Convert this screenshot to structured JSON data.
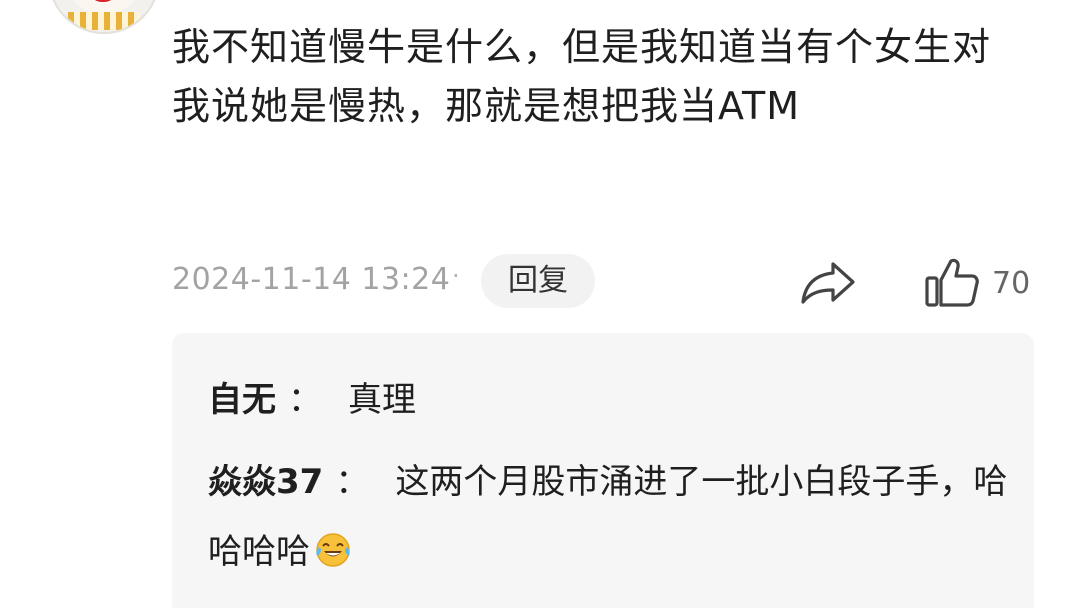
{
  "comment": {
    "text": "我不知道慢牛是什么，但是我知道当有个女生对我说她是慢热，那就是想把我当ATM",
    "timestamp": "2024-11-14 13:24",
    "separator": "·",
    "reply_label": "回复",
    "like_count": "70"
  },
  "replies": [
    {
      "author": "自无",
      "colon": "：",
      "body": "真理"
    },
    {
      "author": "焱焱37",
      "colon": "：",
      "body": "这两个月股市涌进了一批小白段子手，哈哈哈哈",
      "emoji": "tears-of-joy-emoji"
    }
  ],
  "icons": {
    "share": "share-icon",
    "like": "thumbs-up-icon",
    "avatar": "avatar"
  },
  "colors": {
    "text": "#1f1f1f",
    "muted": "#a3a3a3",
    "reply_bg": "#f6f6f6",
    "button_bg": "#f2f2f2"
  }
}
